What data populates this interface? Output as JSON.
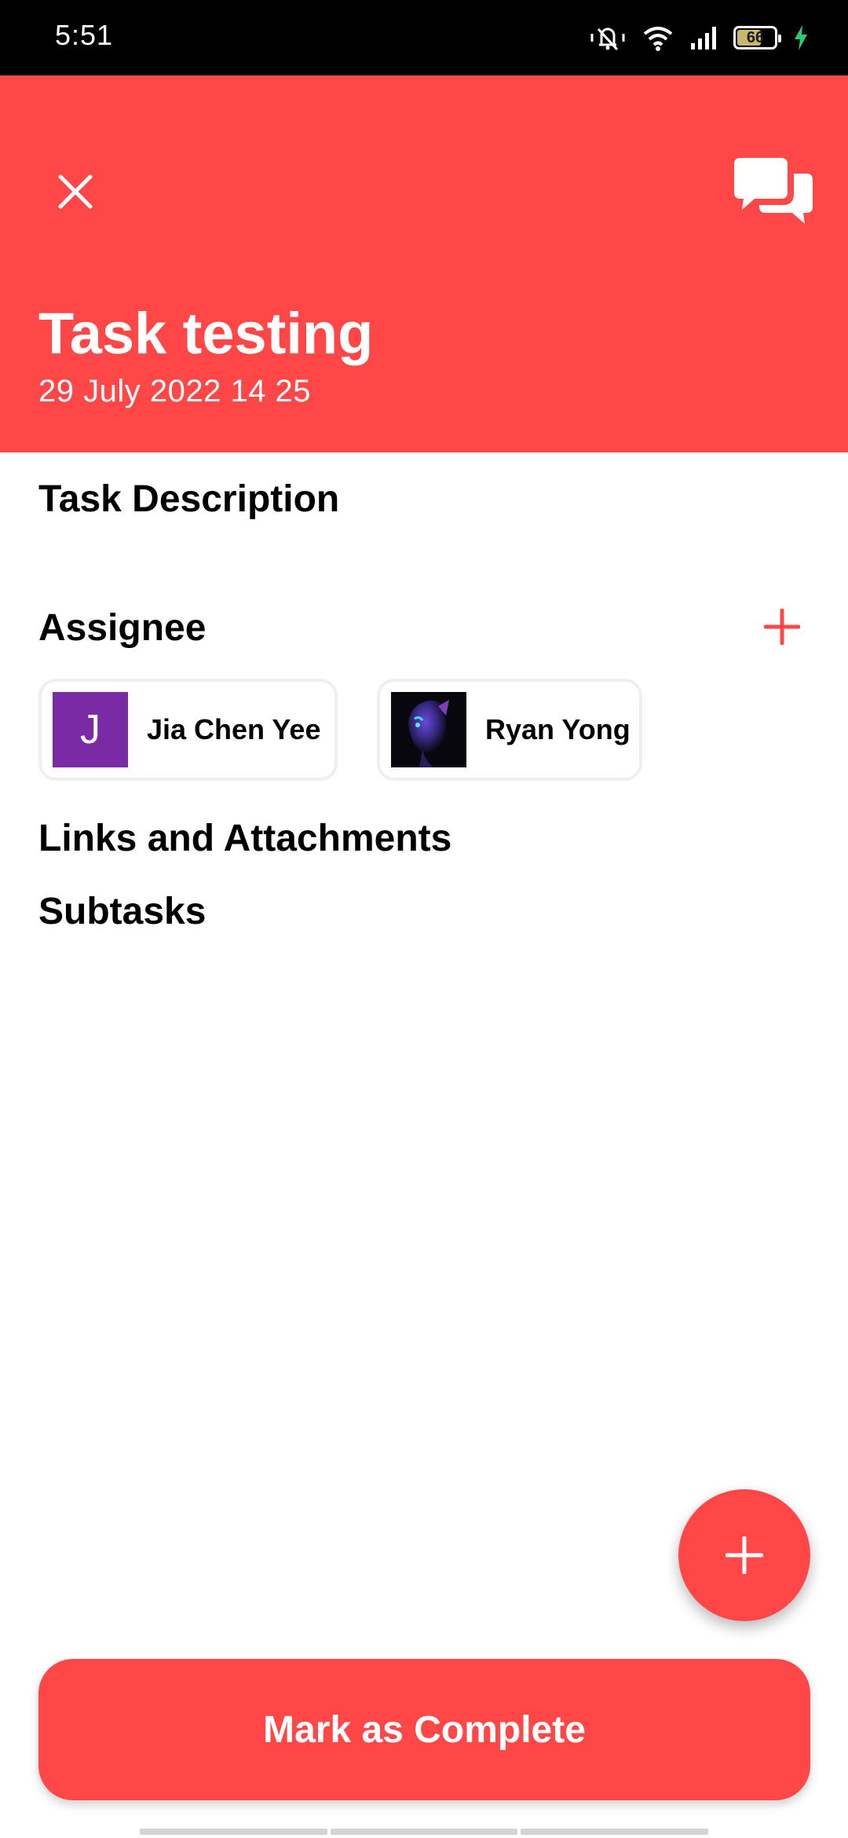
{
  "status_bar": {
    "time": "5:51",
    "battery_level": "66",
    "battery_fraction": 0.66,
    "icons": [
      "vibrate-icon",
      "wifi-icon",
      "signal-icon",
      "battery-icon",
      "charging-icon"
    ]
  },
  "header": {
    "title": "Task testing",
    "date": "29 July 2022 14 25",
    "background_color": "#ff4747",
    "close_icon": "close-icon",
    "chat_icon": "chat-icon"
  },
  "sections": {
    "description_title": "Task Description",
    "assignee_title": "Assignee",
    "links_title": "Links and Attachments",
    "subtasks_title": "Subtasks"
  },
  "assignees": [
    {
      "initial": "J",
      "name": "Jia Chen Yee",
      "avatar_color": "#7b2aa6"
    },
    {
      "name": "Ryan Yong",
      "avatar": "photo"
    }
  ],
  "actions": {
    "add_assignee_icon": "plus-icon",
    "fab_icon": "plus-icon",
    "complete_label": "Mark as Complete"
  },
  "colors": {
    "accent": "#ff4747",
    "text": "#000000"
  }
}
